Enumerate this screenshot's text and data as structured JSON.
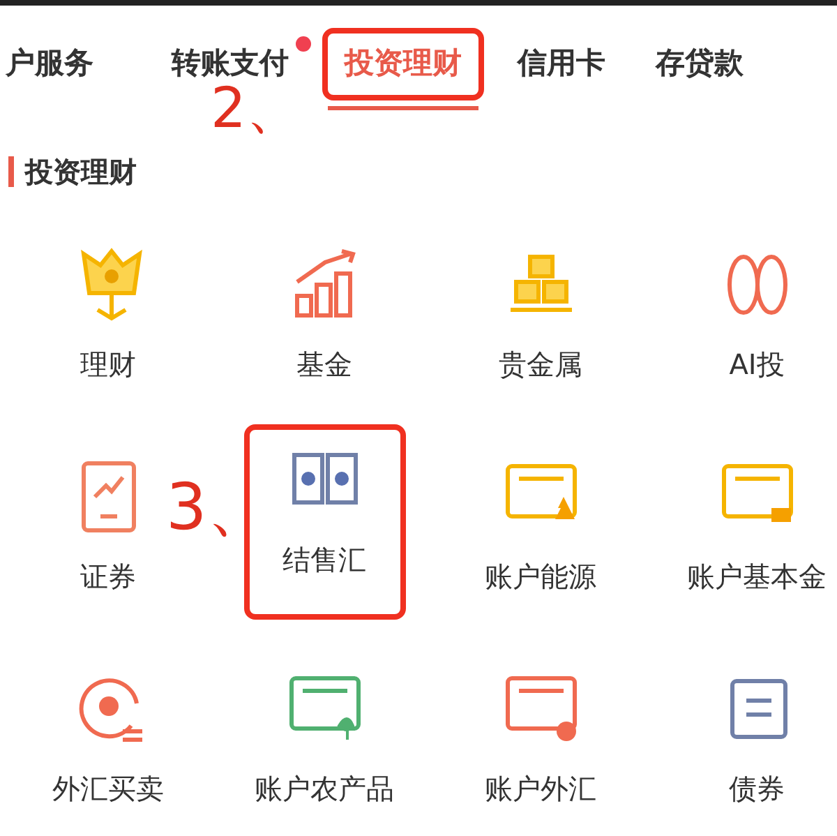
{
  "tabs": [
    {
      "label": "户服务",
      "selected": false,
      "dot": false,
      "highlighted": false
    },
    {
      "label": "转账支付",
      "selected": false,
      "dot": true,
      "highlighted": false
    },
    {
      "label": "投资理财",
      "selected": true,
      "dot": false,
      "highlighted": true,
      "annotation": "2、"
    },
    {
      "label": "信用卡",
      "selected": false,
      "dot": false,
      "highlighted": false
    },
    {
      "label": "存贷款",
      "selected": false,
      "dot": false,
      "highlighted": false
    }
  ],
  "section_title": "投资理财",
  "items": [
    {
      "label": "理财",
      "kind": "flower",
      "highlighted": false
    },
    {
      "label": "基金",
      "kind": "growth",
      "highlighted": false
    },
    {
      "label": "贵金属",
      "kind": "ingot",
      "highlighted": false
    },
    {
      "label": "AI投",
      "kind": "ai",
      "highlighted": false
    },
    {
      "label": "证券",
      "kind": "stock",
      "highlighted": false
    },
    {
      "label": "结售汇",
      "kind": "exchange",
      "highlighted": true,
      "annotation": "3、"
    },
    {
      "label": "账户能源",
      "kind": "flask",
      "highlighted": false
    },
    {
      "label": "账户基本金",
      "kind": "cardingot",
      "highlighted": false
    },
    {
      "label": "外汇买卖",
      "kind": "coin",
      "highlighted": false
    },
    {
      "label": "账户农产品",
      "kind": "leaf",
      "highlighted": false
    },
    {
      "label": "账户外汇",
      "kind": "carddollar",
      "highlighted": false
    },
    {
      "label": "债券",
      "kind": "bond",
      "highlighted": false
    }
  ]
}
